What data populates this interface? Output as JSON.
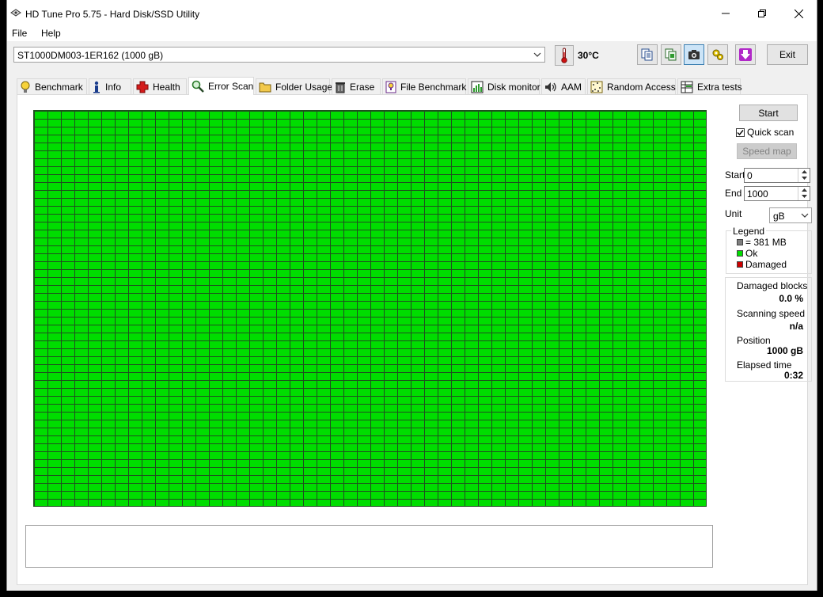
{
  "window": {
    "title": "HD Tune Pro 5.75 - Hard Disk/SSD Utility",
    "minimize_glyph": "─",
    "maximize_glyph": "❐",
    "close_glyph": "✕"
  },
  "menu": {
    "file": "File",
    "help": "Help"
  },
  "toolbar": {
    "drive": "ST1000DM003-1ER162 (1000 gB)",
    "temperature": "30°C",
    "exit_label": "Exit",
    "icons": [
      "copy-text-icon",
      "copy-info-icon",
      "screenshot-camera-icon",
      "options-icon",
      "save-download-icon"
    ]
  },
  "tabs": [
    {
      "label": "Benchmark",
      "icon": "lightbulb-icon"
    },
    {
      "label": "Info",
      "icon": "info-icon"
    },
    {
      "label": "Health",
      "icon": "health-cross-icon"
    },
    {
      "label": "Error Scan",
      "icon": "magnifier-icon",
      "active": true
    },
    {
      "label": "Folder Usage",
      "icon": "folder-icon"
    },
    {
      "label": "Erase",
      "icon": "trash-icon"
    },
    {
      "label": "File Benchmark",
      "icon": "file-benchmark-icon"
    },
    {
      "label": "Disk monitor",
      "icon": "disk-monitor-icon"
    },
    {
      "label": "AAM",
      "icon": "speaker-icon"
    },
    {
      "label": "Random Access",
      "icon": "random-access-icon"
    },
    {
      "label": "Extra tests",
      "icon": "extra-tests-icon"
    }
  ],
  "scan": {
    "start_label": "Start",
    "quick_scan_label": "Quick scan",
    "quick_scan_checked": true,
    "speed_map_label": "Speed map",
    "start_field_label": "Start",
    "start_value": "0",
    "end_field_label": "End",
    "end_value": "1000",
    "unit_label": "Unit",
    "unit_value": "gB",
    "legend": {
      "title": "Legend",
      "block": "= 381 MB",
      "ok": "Ok",
      "damaged": "Damaged",
      "colors": {
        "block": "#7f7f7f",
        "ok": "#00dd00",
        "damaged": "#cc0000"
      }
    },
    "stats": {
      "damaged_label": "Damaged blocks",
      "damaged_value": "0.0 %",
      "speed_label": "Scanning speed",
      "speed_value": "n/a",
      "position_label": "Position",
      "position_value": "1000 gB",
      "elapsed_label": "Elapsed time",
      "elapsed_value": "0:32"
    }
  },
  "colors": {
    "grid_ok": "#00dd00",
    "grid_line": "#1f4f1f"
  }
}
